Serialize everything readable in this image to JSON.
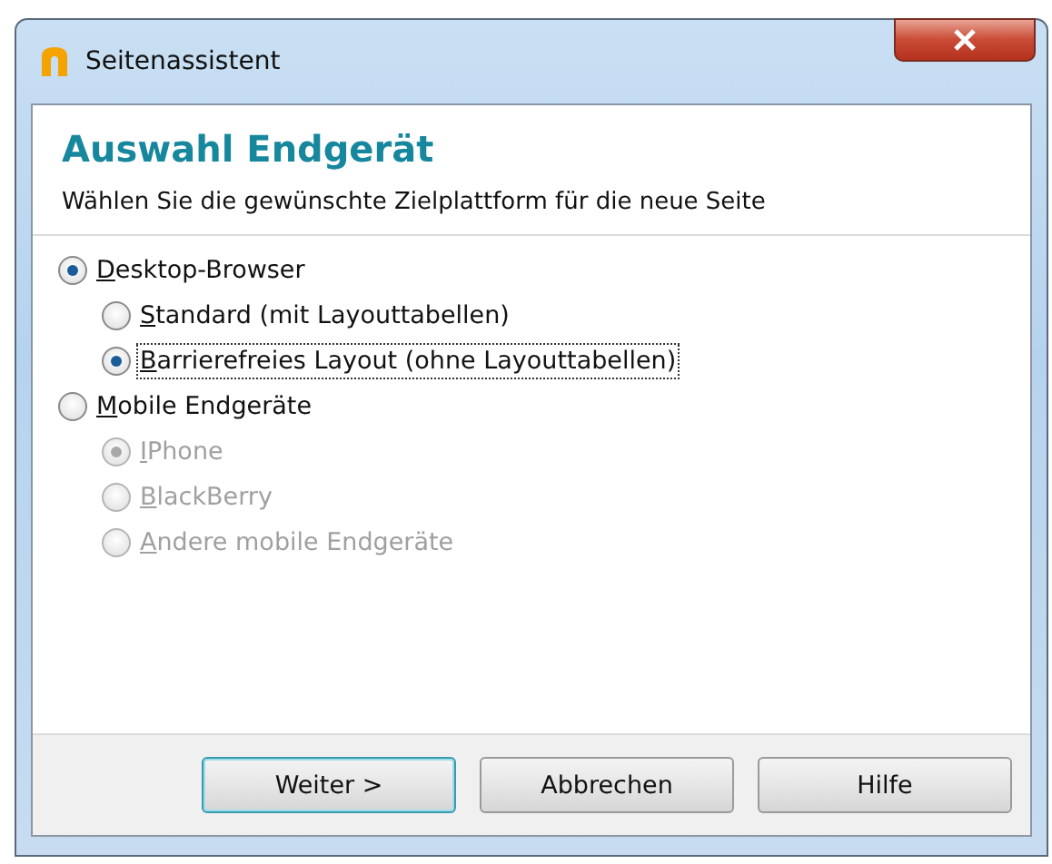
{
  "window": {
    "title": "Seitenassistent"
  },
  "header": {
    "title": "Auswahl Endgerät",
    "subtitle": "Wählen Sie die gewünschte Zielplattform für die neue Seite"
  },
  "options": [
    {
      "label": "Desktop-Browser",
      "selected": true,
      "disabled": false,
      "focused": false,
      "children": [
        {
          "label": "Standard (mit Layouttabellen)",
          "selected": false,
          "disabled": false,
          "focused": false
        },
        {
          "label": "Barrierefreies Layout (ohne Layouttabellen)",
          "selected": true,
          "disabled": false,
          "focused": true
        }
      ]
    },
    {
      "label": "Mobile Endgeräte",
      "selected": false,
      "disabled": false,
      "focused": false,
      "children": [
        {
          "label": "IPhone",
          "selected": true,
          "disabled": true,
          "focused": false
        },
        {
          "label": "BlackBerry",
          "selected": false,
          "disabled": true,
          "focused": false
        },
        {
          "label": "Andere mobile Endgeräte",
          "selected": false,
          "disabled": true,
          "focused": false
        }
      ]
    }
  ],
  "buttons": [
    {
      "label": "Weiter >",
      "default": true
    },
    {
      "label": "Abbrechen",
      "default": false
    },
    {
      "label": "Hilfe",
      "default": false
    }
  ]
}
